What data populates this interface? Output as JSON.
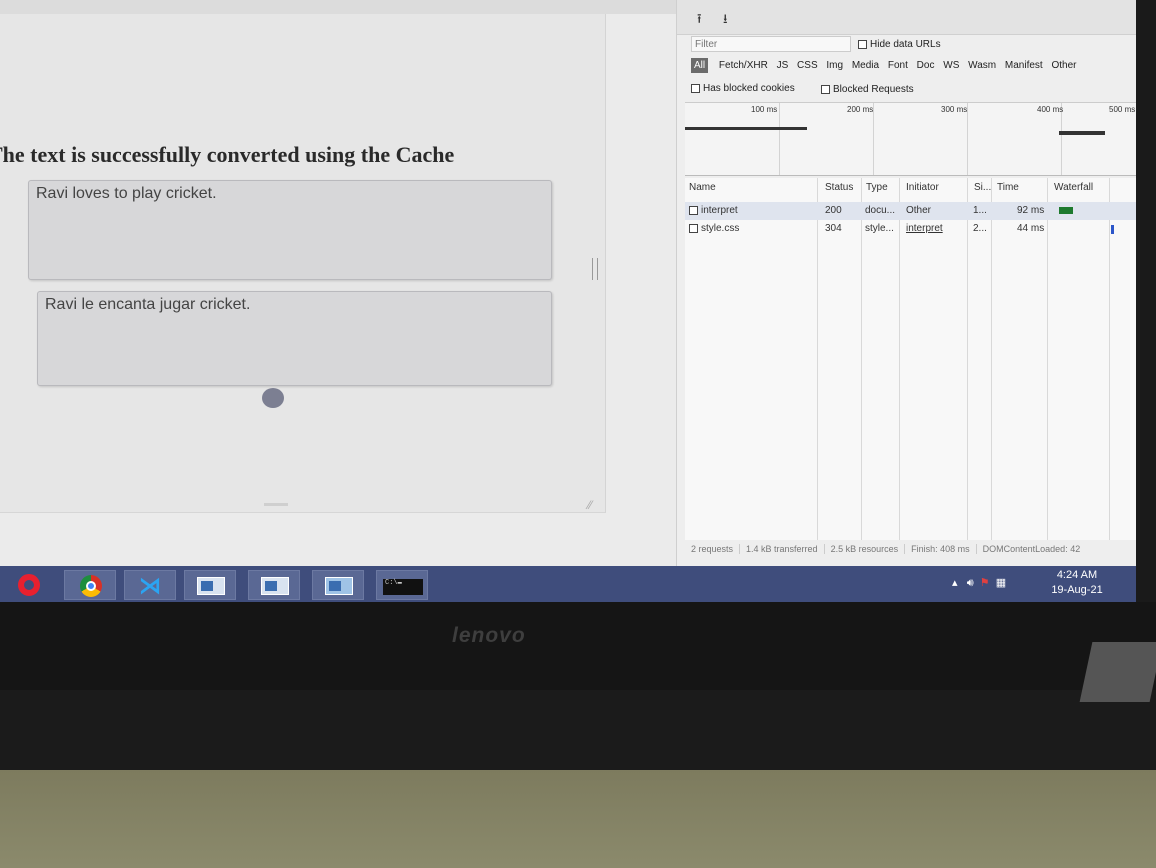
{
  "page": {
    "heading": "The text is successfully converted using the Cache",
    "source_text": "Ravi loves to play cricket.",
    "translated_text": "Ravi le encanta jugar cricket."
  },
  "devtools": {
    "filter_placeholder": "Filter",
    "hide_data_urls_label": "Hide data URLs",
    "type_filters": [
      "All",
      "Fetch/XHR",
      "JS",
      "CSS",
      "Img",
      "Media",
      "Font",
      "Doc",
      "WS",
      "Wasm",
      "Manifest",
      "Other"
    ],
    "has_blocked_cookies_label": "Has blocked cookies",
    "blocked_requests_label": "Blocked Requests",
    "timeline_ticks": [
      "100 ms",
      "200 ms",
      "300 ms",
      "400 ms",
      "500 ms"
    ],
    "columns": {
      "name": "Name",
      "status": "Status",
      "type": "Type",
      "initiator": "Initiator",
      "size": "Si...",
      "time": "Time",
      "waterfall": "Waterfall"
    },
    "requests": [
      {
        "name": "interpret",
        "status": "200",
        "type": "docu...",
        "initiator": "Other",
        "size": "1...",
        "time": "92 ms"
      },
      {
        "name": "style.css",
        "status": "304",
        "type": "style...",
        "initiator": "interpret",
        "size": "2...",
        "time": "44 ms"
      }
    ],
    "status_bar": {
      "requests": "2 requests",
      "transferred": "1.4 kB transferred",
      "resources": "2.5 kB resources",
      "finish": "Finish: 408 ms",
      "dom_loaded": "DOMContentLoaded: 42"
    }
  },
  "taskbar": {
    "time": "4:24 AM",
    "date": "19-Aug-21",
    "apps": [
      "opera",
      "chrome",
      "vscode",
      "window",
      "window",
      "network",
      "command-prompt"
    ]
  },
  "laptop": {
    "brand": "lenovo"
  }
}
